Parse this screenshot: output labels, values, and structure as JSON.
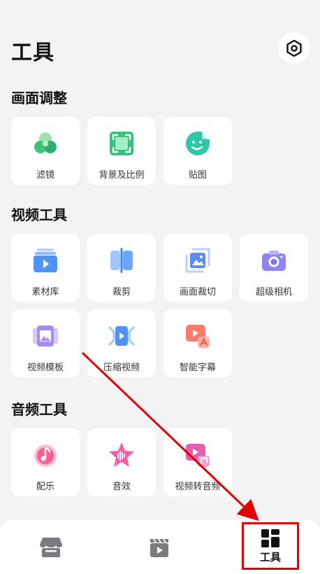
{
  "page": {
    "title": "工具"
  },
  "sections": [
    {
      "title": "画面调整",
      "items": [
        {
          "label": "滤镜",
          "icon": "filter-icon"
        },
        {
          "label": "背景及比例",
          "icon": "background-ratio-icon"
        },
        {
          "label": "贴图",
          "icon": "sticker-icon"
        }
      ]
    },
    {
      "title": "视频工具",
      "items": [
        {
          "label": "素材库",
          "icon": "material-library-icon"
        },
        {
          "label": "裁剪",
          "icon": "trim-icon"
        },
        {
          "label": "画面裁切",
          "icon": "crop-icon"
        },
        {
          "label": "超级相机",
          "icon": "super-camera-icon"
        },
        {
          "label": "视频模板",
          "icon": "video-template-icon"
        },
        {
          "label": "压缩视频",
          "icon": "compress-video-icon"
        },
        {
          "label": "智能字幕",
          "icon": "smart-subtitle-icon"
        }
      ]
    },
    {
      "title": "音频工具",
      "items": [
        {
          "label": "配乐",
          "icon": "music-icon"
        },
        {
          "label": "音效",
          "icon": "sound-effect-icon"
        },
        {
          "label": "视频转音频",
          "icon": "video-to-audio-icon"
        }
      ]
    }
  ],
  "tabbar": {
    "tools_label": "工具",
    "icons": [
      "store-icon",
      "clapperboard-icon",
      "tools-grid-icon"
    ]
  },
  "colors": {
    "highlight": "#e00000",
    "background": "#f3f3f6"
  }
}
